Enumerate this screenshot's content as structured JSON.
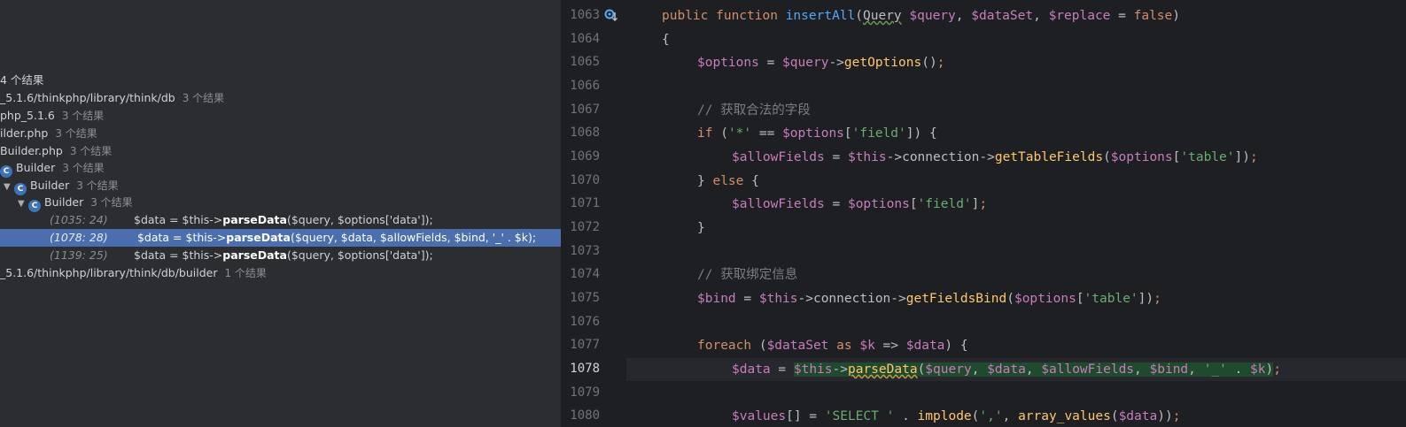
{
  "find_panel": {
    "rows": [
      {
        "text": "4 个结果",
        "count": "",
        "indent": 0
      },
      {
        "text": "_5.1.6/thinkphp/library/think/db",
        "count": "3 个结果",
        "indent": 0
      },
      {
        "text": "php_5.1.6",
        "count": "3 个结果",
        "indent": 0
      },
      {
        "text": "ilder.php",
        "count": "3 个结果",
        "indent": 0
      },
      {
        "text": "Builder.php",
        "count": "3 个结果",
        "indent": 1
      },
      {
        "text": "Builder",
        "count": "3 个结果",
        "indent": 2
      },
      {
        "text": "Builder",
        "count": "3 个结果",
        "indent": 3
      },
      {
        "text": "Builder",
        "count": "3 个结果",
        "indent": 4
      },
      {
        "loc": "(1035: 24)",
        "pre": "$data = $this->",
        "bold": "parseData",
        "post": "($query, $options['data']);"
      },
      {
        "loc": "(1078: 28)",
        "pre": "  $data = $this->",
        "bold": "parseData",
        "post": "($query, $data, $allowFields, $bind, '_' . $k);"
      },
      {
        "loc": "(1139: 25)",
        "pre": "$data  = $this->",
        "bold": "parseData",
        "post": "($query, $options['data']);"
      },
      {
        "text": "_5.1.6/thinkphp/library/think/db/builder",
        "count": "1 个结果",
        "indent": 0
      }
    ]
  },
  "editor": {
    "line_numbers": [
      "1063",
      "1064",
      "1065",
      "1066",
      "1067",
      "1068",
      "1069",
      "1070",
      "1071",
      "1072",
      "1073",
      "1074",
      "1075",
      "1076",
      "1077",
      "1078",
      "1079",
      "1080"
    ],
    "current_line": "1078",
    "lines": [
      "public function insertAll(Query $query, $dataSet, $replace = false)",
      "{",
      "$options = $query->getOptions();",
      "",
      "// 获取合法的字段",
      "if ('*' == $options['field']) {",
      "$allowFields = $this->connection->getTableFields($options['table']);",
      "} else {",
      "$allowFields = $options['field'];",
      "}",
      "",
      "// 获取绑定信息",
      "$bind = $this->connection->getFieldsBind($options['table']);",
      "",
      "foreach ($dataSet as $k => $data) {",
      "$data = $this->parseData($query, $data, $allowFields, $bind, '_' . $k);",
      "",
      "$values[] = 'SELECT ' . implode(',', array_values($data));"
    ]
  },
  "icons": {
    "gutter": "implements-method-icon",
    "class": "class-icon"
  },
  "colors": {
    "selection": "#4b6eaf",
    "editor_bg": "#1e1f22",
    "panel_bg": "#2b2d30"
  }
}
